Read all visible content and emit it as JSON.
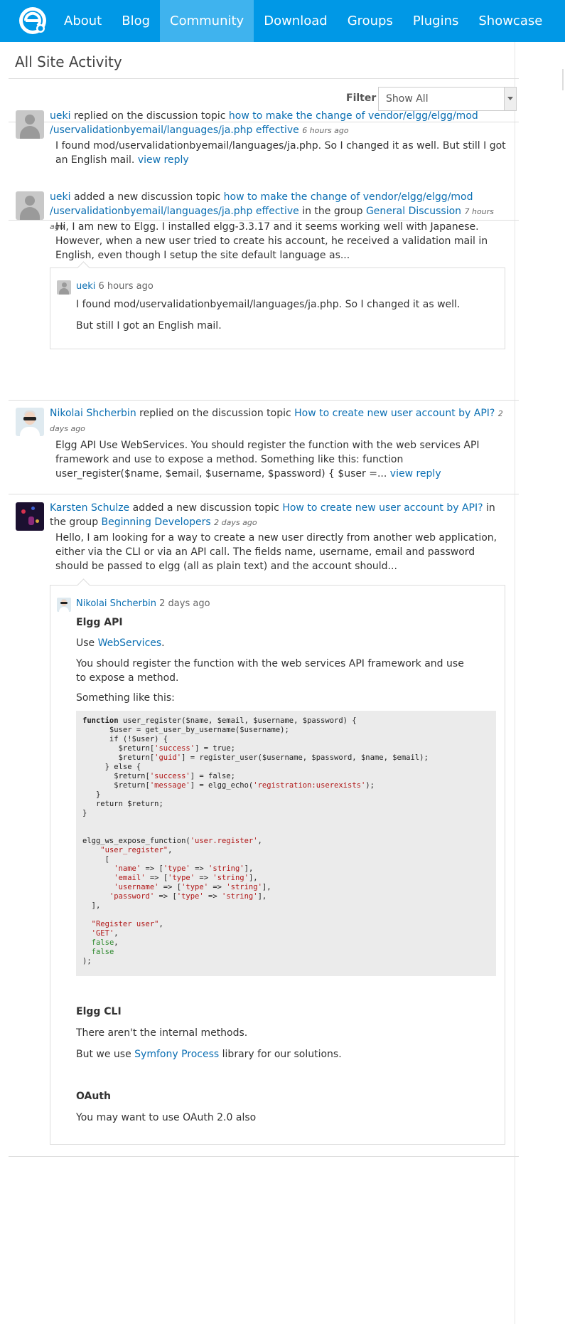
{
  "nav": {
    "logo_icon": "elgg-logo-icon",
    "items": [
      {
        "label": "About"
      },
      {
        "label": "Blog"
      },
      {
        "label": "Community",
        "active": true
      },
      {
        "label": "Download"
      },
      {
        "label": "Groups"
      },
      {
        "label": "Plugins"
      },
      {
        "label": "Showcase"
      }
    ]
  },
  "colors": {
    "topbar": "#0098e6",
    "active_tab": "#3fb3ee",
    "link": "#0b6fb3"
  },
  "page": {
    "title": "All Site Activity",
    "filter_label": "Filter",
    "filter_value": "Show All"
  },
  "activity": [
    {
      "user": "ueki",
      "action": "replied on the discussion topic",
      "target": "how to make the change of vendor/elgg/elgg/mod /uservalidationbyemail/languages/ja.php effective",
      "time": "6 hours ago",
      "excerpt": "I found mod/uservalidationbyemail/languages/ja.php. So I changed it as well. But still I got an English mail.",
      "more": "view reply"
    },
    {
      "user": "ueki",
      "action": "added a new discussion topic",
      "target": "how to make the change of vendor/elgg/elgg/mod /uservalidationbyemail/languages/ja.php effective",
      "in_group": "in the group",
      "group": "General Discussion",
      "time": "7 hours ago",
      "excerpt": "Hi, I am new to Elgg. I installed elgg-3.3.17 and it seems working well with Japanese. However, when a new user tried to create his account, he received a validation mail in English, even though I setup the site default language as...",
      "reply": {
        "user": "ueki",
        "time": "6 hours ago",
        "p1": "I found mod/uservalidationbyemail/languages/ja.php. So I changed it as well.",
        "p2": "But still I got an English mail."
      }
    },
    {
      "user": "Nikolai Shcherbin",
      "action": "replied on the discussion topic",
      "target": "How to create new user account by API?",
      "time": "2 days ago",
      "excerpt": "Elgg API Use WebServices. You should register the function with the web services API framework and use to expose a method. Something like this: function user_register($name, $email, $username, $password) { $user =...",
      "more": "view reply"
    },
    {
      "user": "Karsten Schulze",
      "action": "added a new discussion topic",
      "target": "How to create new user account by API?",
      "in_group": "in the group",
      "group": "Beginning Developers",
      "time": "2 days ago",
      "excerpt": "Hello, I am looking for a way to create a new user directly from another web application, either via the CLI or via an API call. The fields name, username, email and password should be passed to elgg (all as plain text) and the account should...",
      "reply": {
        "user": "Nikolai Shcherbin",
        "time": "2 days ago",
        "heading1": "Elgg API",
        "use_prefix": "Use",
        "use_link": "WebServices",
        "use_suffix": ".",
        "p_register": "You should register the function with the web services API framework and use to expose a method.",
        "p_like": "Something like this:",
        "heading2": "Elgg CLI",
        "p_internal": "There aren't the internal methods.",
        "p_but_prefix": "But we use",
        "p_but_link": "Symfony Process",
        "p_but_suffix": "library for our solutions.",
        "heading3": "OAuth",
        "p_oauth": "You may want to use OAuth 2.0 also"
      }
    }
  ]
}
